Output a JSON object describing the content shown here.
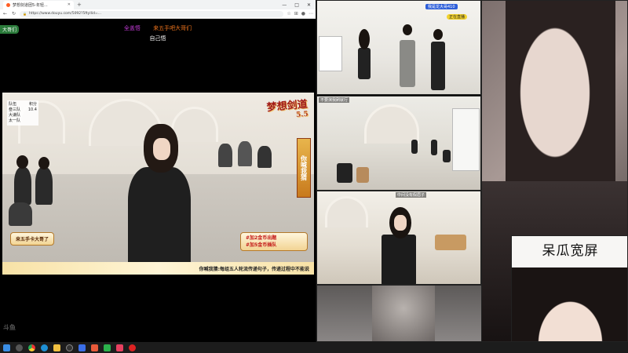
{
  "browser": {
    "tab_title": "梦想剑道团5-年轻...",
    "url": "https://www.douyu.com/5092?5ftyllid=...",
    "window_controls": [
      "—",
      "□",
      "✕"
    ]
  },
  "stream": {
    "side_badge": "大哥们",
    "banner_left": "全盖悟",
    "banner_right": "来五手吧大哥们",
    "banner_sub": "自己悟",
    "scoreboard": {
      "headers": [
        "队伍",
        "积分"
      ],
      "rows": [
        [
          "叁三队",
          "10.4"
        ],
        [
          "大谦队",
          ""
        ],
        [
          "太一队",
          ""
        ]
      ]
    },
    "logo": "梦想剑道",
    "logo_sub": "5.5",
    "side_banner": "你喊我猜",
    "overlay_left": "来五手卡大哥了",
    "overlay_right_lines": [
      "#加2金币出题",
      "#加5金币插队"
    ],
    "bottom_bar": "你喊我猜:每组五人轮流传递句子，传递过程中不能说",
    "watermark": "斗鱼"
  },
  "feeds": {
    "feed1_badge": "我是龙大哥410",
    "feed1_badge2": "正在直播",
    "feed1_label": "",
    "feed2_label": "不要演我刷就行",
    "feed3_label": "中间没有假眉子",
    "cam_title": "呆瓜宽屏"
  },
  "taskbar": {
    "icons": [
      "windows-icon",
      "search-icon",
      "chrome-icon",
      "edge-icon",
      "explorer-icon",
      "obs-icon",
      "app-icon",
      "app-icon",
      "wechat-icon",
      "app-icon",
      "record-icon"
    ]
  }
}
